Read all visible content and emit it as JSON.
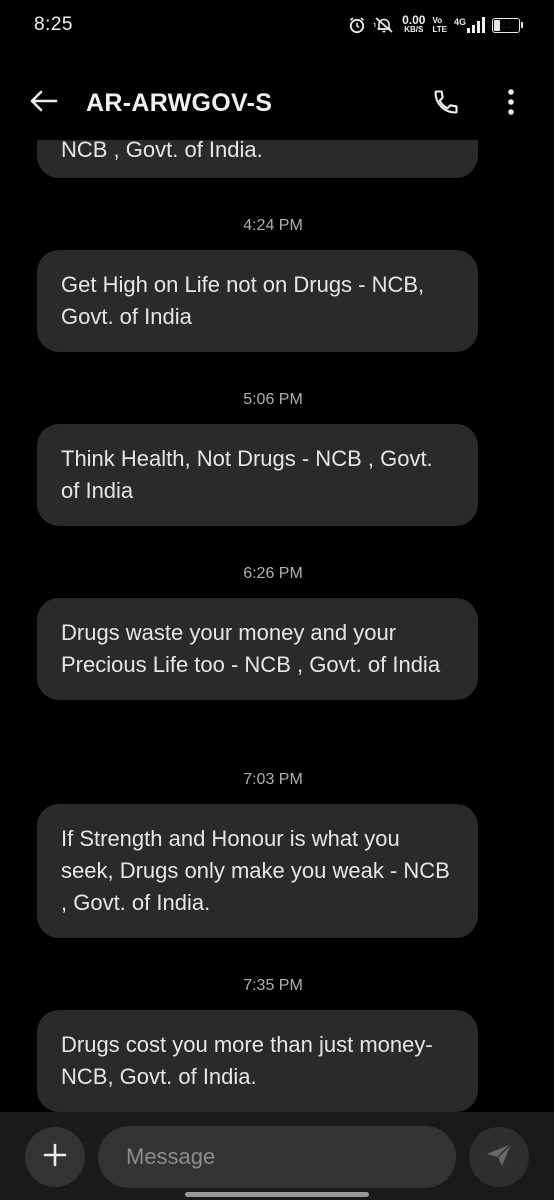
{
  "status_bar": {
    "time": "8:25",
    "net_speed_value": "0.00",
    "net_speed_unit": "KB/S",
    "volte_top": "Vo",
    "volte_bottom": "LTE",
    "network_type": "4G",
    "battery_level": "22",
    "battery_fraction": 0.22,
    "icons": [
      "alarm-icon",
      "muted-bell-icon",
      "signal-icon",
      "battery-icon"
    ]
  },
  "header": {
    "title": "AR-ARWGOV-S",
    "icons": [
      "back-arrow-icon",
      "phone-icon",
      "more-vertical-icon"
    ]
  },
  "thread": {
    "partial_top_text": "NCB , Govt. of India.",
    "messages": [
      {
        "time": "4:24 PM",
        "text": "Get High on Life not on Drugs - NCB, Govt. of India"
      },
      {
        "time": "5:06 PM",
        "text": "Think Health, Not Drugs - NCB , Govt. of India"
      },
      {
        "time": "6:26 PM",
        "text": "Drugs waste your money and your Precious Life too - NCB , Govt. of India"
      },
      {
        "time": "7:03 PM",
        "text": "If Strength and Honour is what you seek, Drugs only make you weak - NCB , Govt. of India."
      },
      {
        "time": "7:35 PM",
        "text": "Drugs cost you more than just money-NCB, Govt. of India."
      }
    ]
  },
  "composer": {
    "placeholder": "Message",
    "icons": [
      "plus-icon",
      "send-icon"
    ]
  },
  "colors": {
    "background": "#000000",
    "bubble": "#2a2a2a",
    "composer_bar": "#1a1a1a",
    "text": "#e6e6e6",
    "timestamp": "#b0b0b0"
  }
}
